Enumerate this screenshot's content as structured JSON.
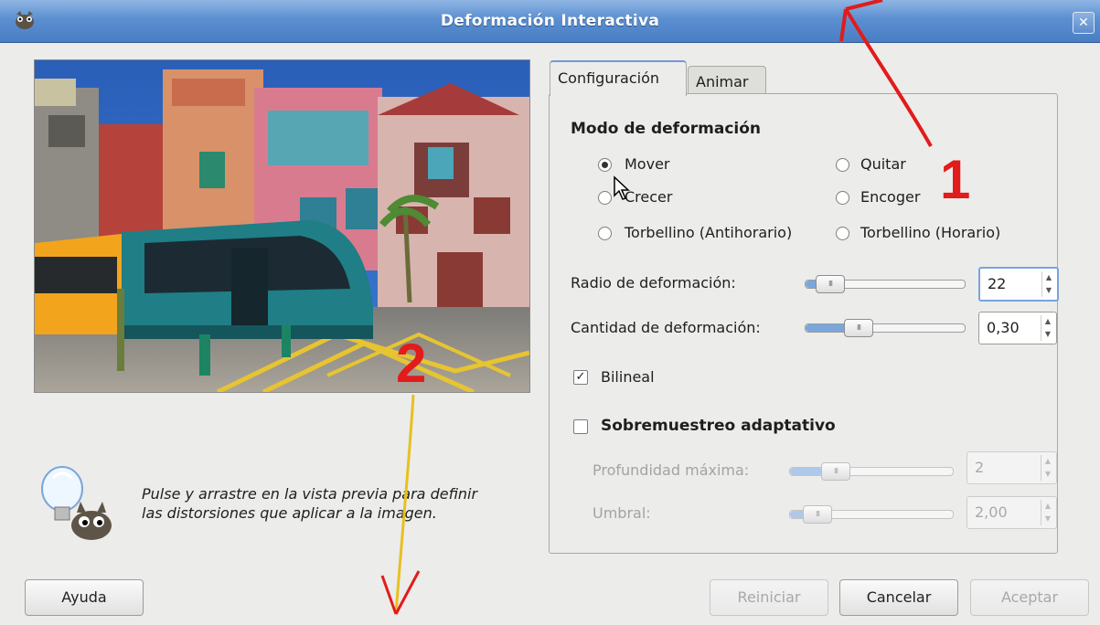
{
  "window": {
    "title": "Deformación Interactiva",
    "close_glyph": "✕"
  },
  "tabs": [
    {
      "label": "Configuración",
      "mnemonic": "f",
      "active": true
    },
    {
      "label": "Animar",
      "mnemonic": "A",
      "active": false
    }
  ],
  "mode_section": {
    "title": "Modo de deformación",
    "options": [
      {
        "label": "Mover",
        "selected": true
      },
      {
        "label": "Quitar",
        "selected": false
      },
      {
        "label": "Crecer",
        "selected": false
      },
      {
        "label": "Encoger",
        "selected": false
      },
      {
        "label": "Torbellino (Antihorario)",
        "selected": false
      },
      {
        "label": "Torbellino (Horario)",
        "selected": false
      }
    ]
  },
  "radius": {
    "label": "Radio de deformación:",
    "value": "22",
    "slider_fraction": 0.12
  },
  "amount": {
    "label": "Cantidad de deformación:",
    "value": "0,30",
    "slider_fraction": 0.3
  },
  "bilinear": {
    "label": "Bilineal",
    "checked": true
  },
  "adaptive": {
    "label": "Sobremuestreo adaptativo",
    "checked": false,
    "max_depth": {
      "label": "Profundidad máxima:",
      "value": "2",
      "slider_fraction": 0.2
    },
    "threshold": {
      "label": "Umbral:",
      "value": "2,00",
      "slider_fraction": 0.1
    }
  },
  "hint": {
    "line1": "Pulse y arrastre en la vista previa para definir",
    "line2": "las distorsiones que aplicar a la imagen."
  },
  "buttons": {
    "help": "Ayuda",
    "reset": "Reiniciar",
    "cancel": "Cancelar",
    "ok": "Aceptar"
  },
  "annotations": {
    "one": "1",
    "two": "2",
    "color": "#e21b1b"
  },
  "colors": {
    "titlebar": "#5b8fd0",
    "dialog_bg": "#ececea",
    "slider_fill": "#7aa6dd"
  }
}
